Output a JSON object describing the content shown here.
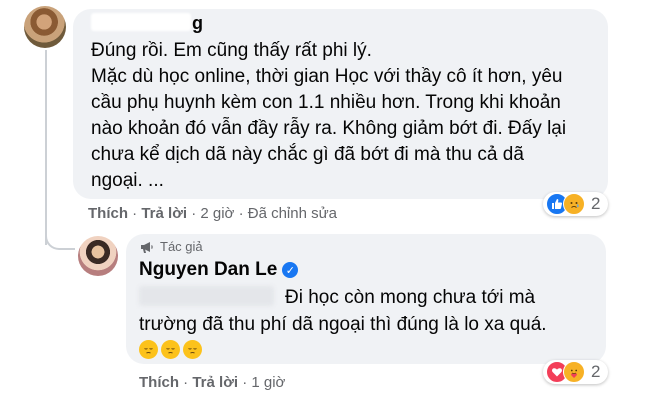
{
  "comment": {
    "author_visible_fragment": "g",
    "lines": [
      "Đúng rồi. Em cũng thấy rất phi lý.",
      "Mặc dù học online, thời gian Học với thầy cô ít hơn, yêu",
      "cầu phụ huynh kèm con 1.1 nhiều hơn. Trong khi khoản",
      "nào khoản đó vẫn đầy rẫy ra. Không giảm bớt đi. Đấy lại",
      "chưa kể dịch dã này chắc gì đã bớt đi mà thu cả dã",
      "ngoại. ..."
    ],
    "reaction_count": "2",
    "reaction_icons": [
      "like-icon",
      "sad-icon"
    ],
    "actions": {
      "like": "Thích",
      "reply": "Trả lời",
      "time": "2 giờ",
      "edited": "Đã chỉnh sửa",
      "separator": "·"
    }
  },
  "reply": {
    "badge": "Tác giả",
    "author": "Nguyen Dan Le",
    "lines": [
      "Đi học còn mong chưa tới mà",
      "trường đã thu phí dã ngoại thì đúng là lo xa quá."
    ],
    "emojis": [
      "😔",
      "😔",
      "😔"
    ],
    "reaction_count": "2",
    "reaction_icons": [
      "love-icon",
      "care-icon"
    ],
    "actions": {
      "like": "Thích",
      "reply": "Trả lời",
      "time": "1 giờ",
      "separator": "·"
    }
  },
  "colors": {
    "bubble": "#f0f2f5",
    "text": "#050505",
    "meta": "#65676b",
    "accent": "#1877f2",
    "love": "#f33e58",
    "sad": "#f7b125"
  }
}
